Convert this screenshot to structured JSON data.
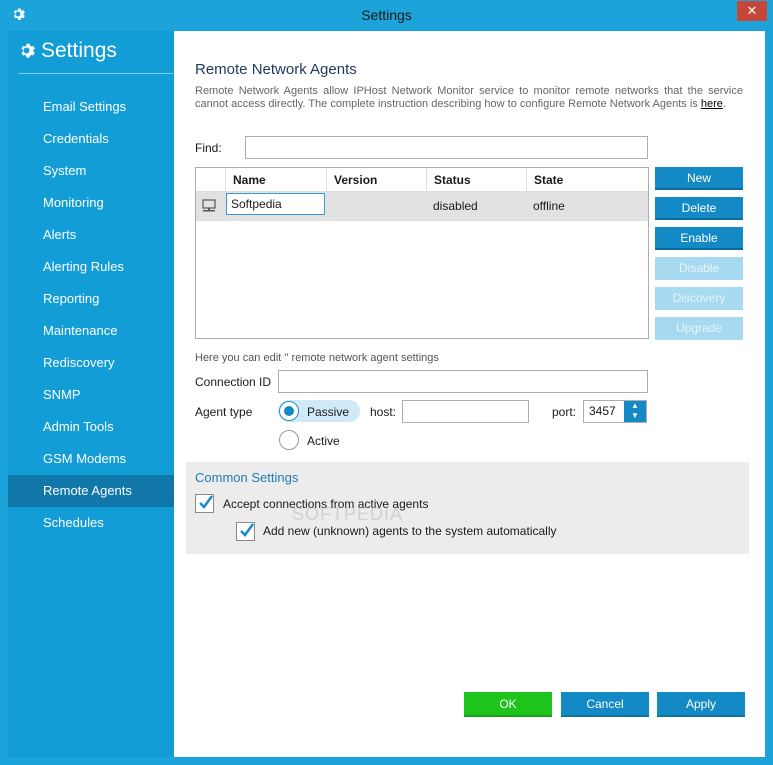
{
  "window": {
    "title": "Settings",
    "close_glyph": "✕",
    "icon": "gear-icon"
  },
  "sidebar": {
    "heading": "Settings",
    "items": [
      {
        "label": "Email Settings"
      },
      {
        "label": "Credentials"
      },
      {
        "label": "System"
      },
      {
        "label": "Monitoring"
      },
      {
        "label": "Alerts"
      },
      {
        "label": "Alerting Rules"
      },
      {
        "label": "Reporting"
      },
      {
        "label": "Maintenance"
      },
      {
        "label": "Rediscovery"
      },
      {
        "label": "SNMP"
      },
      {
        "label": "Admin Tools"
      },
      {
        "label": "GSM Modems"
      },
      {
        "label": "Remote Agents",
        "active": true
      },
      {
        "label": "Schedules"
      }
    ]
  },
  "main": {
    "title": "Remote Network Agents",
    "description": "Remote Network Agents allow IPHost Network Monitor service to monitor remote networks that the service cannot access directly. The complete instruction describing how to configure Remote Network Agents is ",
    "description_link": "here",
    "description_end": ".",
    "find_label": "Find:",
    "find_value": "",
    "table": {
      "columns": [
        "Name",
        "Version",
        "Status",
        "State"
      ],
      "rows": [
        {
          "name": "Softpedia",
          "version": "",
          "status": "disabled",
          "state": "offline"
        }
      ]
    },
    "actions": {
      "new": "New",
      "delete": "Delete",
      "enable": "Enable",
      "disable": "Disable",
      "discovery": "Discovery",
      "upgrade": "Upgrade"
    },
    "edit_note": "Here you can edit '' remote network agent settings",
    "connection_id_label": "Connection ID",
    "connection_id_value": "",
    "agent_type_label": "Agent type",
    "agent_type_options": [
      "Passive",
      "Active"
    ],
    "agent_type_selected": "Passive",
    "host_label": "host:",
    "host_value": "",
    "port_label": "port:",
    "port_value": "3457",
    "common": {
      "title": "Common Settings",
      "accept_label": "Accept connections from active agents",
      "accept_checked": true,
      "add_label": "Add new (unknown) agents to the system automatically",
      "add_checked": true
    }
  },
  "footer": {
    "ok": "OK",
    "cancel": "Cancel",
    "apply": "Apply"
  },
  "watermark": "SOFTPEDIA",
  "colors": {
    "accent": "#1389c6",
    "sidebar": "#139dd7",
    "sidebar_active": "#1176a8",
    "ok": "#1cc41c"
  }
}
